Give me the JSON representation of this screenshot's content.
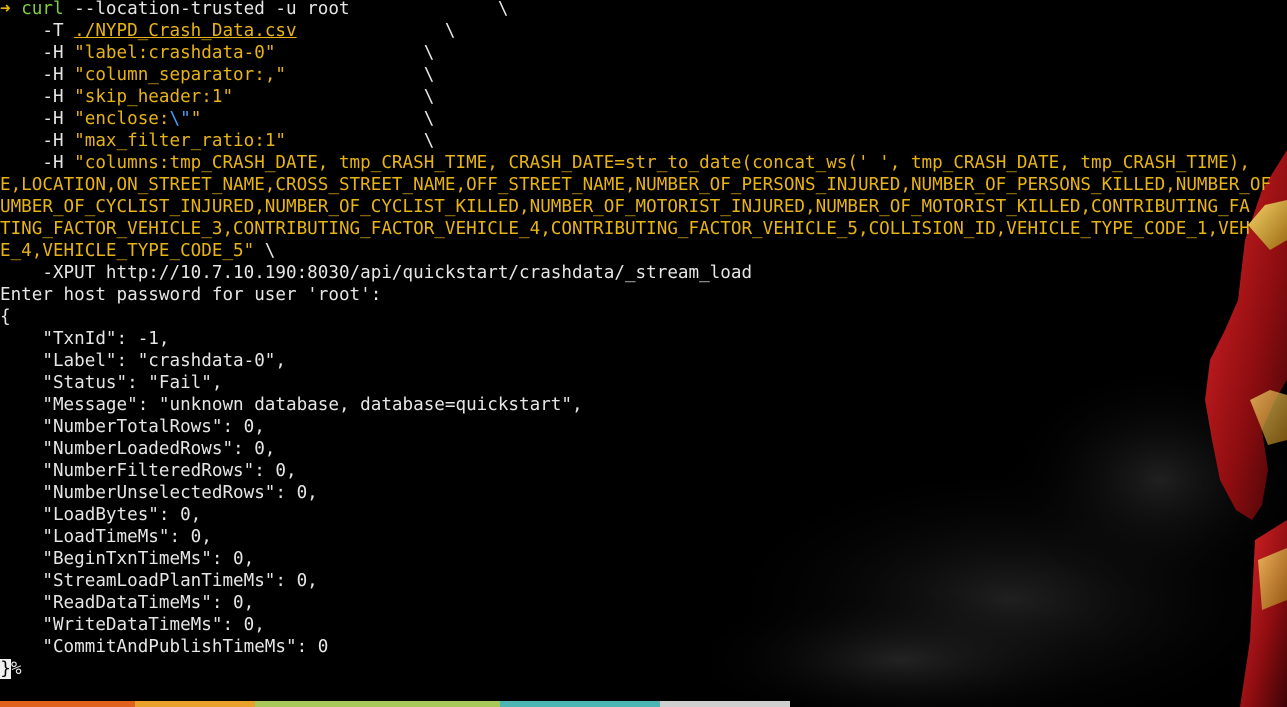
{
  "terminal": {
    "prompt_symbol": "➜",
    "command": {
      "bin": "curl",
      "args": " --location-trusted -u root",
      "cont1": "              \\",
      "line_t_flag": "    -T ",
      "file": "./NYPD_Crash_Data.csv",
      "cont_t": "              \\",
      "header_flag": "    -H ",
      "h_label": "\"label:crashdata-0\"",
      "cont_label": "              \\",
      "h_sep": "\"column_separator:,\"",
      "cont_sep": "             \\",
      "h_skip": "\"skip_header:1\"",
      "cont_skip": "                  \\",
      "h_enclose_a": "\"enclose:",
      "h_enclose_esc": "\\\"",
      "h_enclose_b": "\"",
      "cont_enclose": "                     \\",
      "h_ratio": "\"max_filter_ratio:1\"",
      "cont_ratio": "             \\",
      "h_columns_1": "\"columns:tmp_CRASH_DATE, tmp_CRASH_TIME, CRASH_DATE=str_to_date(concat_ws(' ', tmp_CRASH_DATE, tmp_CRASH_TIME),",
      "wrap_2": "E,LOCATION,ON_STREET_NAME,CROSS_STREET_NAME,OFF_STREET_NAME,NUMBER_OF_PERSONS_INJURED,NUMBER_OF_PERSONS_KILLED,NUMBER_OF",
      "wrap_3": "UMBER_OF_CYCLIST_INJURED,NUMBER_OF_CYCLIST_KILLED,NUMBER_OF_MOTORIST_INJURED,NUMBER_OF_MOTORIST_KILLED,CONTRIBUTING_FA",
      "wrap_4": "TING_FACTOR_VEHICLE_3,CONTRIBUTING_FACTOR_VEHICLE_4,CONTRIBUTING_FACTOR_VEHICLE_5,COLLISION_ID,VEHICLE_TYPE_CODE_1,VEH",
      "wrap_5": "E_4,VEHICLE_TYPE_CODE_5\"",
      "cont_columns": " \\",
      "xput_line": "    -XPUT http://10.7.10.190:8030/api/quickstart/crashdata/_stream_load"
    },
    "password_prompt": "Enter host password for user 'root':",
    "response": {
      "open": "{",
      "lines": [
        "    \"TxnId\": -1,",
        "    \"Label\": \"crashdata-0\",",
        "    \"Status\": \"Fail\",",
        "    \"Message\": \"unknown database, database=quickstart\",",
        "    \"NumberTotalRows\": 0,",
        "    \"NumberLoadedRows\": 0,",
        "    \"NumberFilteredRows\": 0,",
        "    \"NumberUnselectedRows\": 0,",
        "    \"LoadBytes\": 0,",
        "    \"LoadTimeMs\": 0,",
        "    \"BeginTxnTimeMs\": 0,",
        "    \"StreamLoadPlanTimeMs\": 0,",
        "    \"ReadDataTimeMs\": 0,",
        "    \"WriteDataTimeMs\": 0,",
        "    \"CommitAndPublishTimeMs\": 0"
      ],
      "close": "}",
      "eol_marker": "%"
    },
    "statusbar": {
      "segments": [
        {
          "text": " ",
          "color": "#e0611b"
        },
        {
          "text": " ",
          "color": "#e8a12a"
        },
        {
          "text": " ",
          "color": "#a8c95a"
        },
        {
          "text": " ",
          "color": "#4cb6b4"
        },
        {
          "text": " ",
          "color": "#cfcfcf"
        }
      ]
    }
  },
  "colors": {
    "background": "#000000",
    "string": "#e8b414",
    "command": "#7fd13b",
    "escape": "#3ea0ff",
    "text": "#e6e6e6"
  }
}
